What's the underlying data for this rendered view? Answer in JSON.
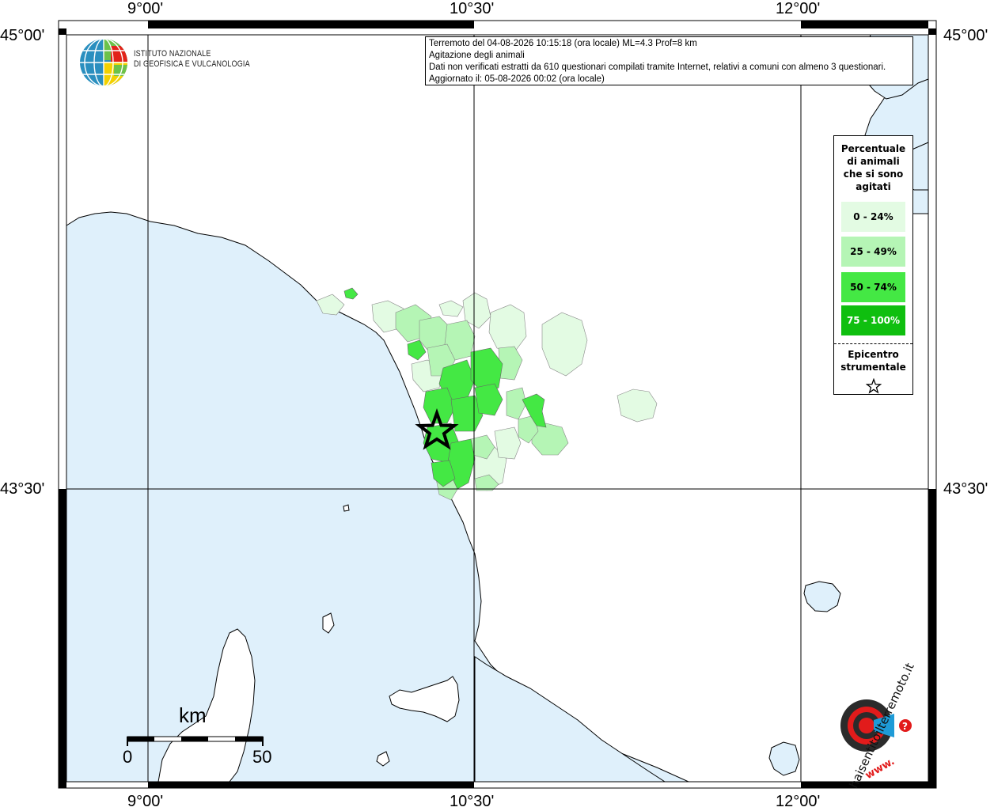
{
  "map": {
    "longitude_labels": [
      "9°00'",
      "10°30'",
      "12°00'"
    ],
    "latitude_labels": [
      "45°00'",
      "43°30'"
    ],
    "colors": {
      "sea": "#dff0fb",
      "land": "#ffffff",
      "class_0_24": "#e3fbe3",
      "class_25_49": "#b5f5b5",
      "class_50_74": "#44e844",
      "class_75_100": "#0fbf0f"
    }
  },
  "logo": {
    "line1": "ISTITUTO NAZIONALE",
    "line2": "DI GEOFISICA E VULCANOLOGIA"
  },
  "info": {
    "line1": "Terremoto del 04-08-2026 10:15:18 (ora locale) ML=4.3 Prof=8 km",
    "line2": "Agitazione degli animali",
    "line3": "Dati non verificati estratti da 610 questionari compilati tramite Internet, relativi a comuni con almeno 3 questionari.",
    "line4": "Aggiornato il: 05-08-2026 00:02 (ora locale)"
  },
  "legend": {
    "title_lines": [
      "Percentuale",
      "di animali",
      "che si sono",
      "agitati"
    ],
    "items": [
      {
        "label": "0 - 24%",
        "color": "#e3fbe3",
        "text_color": "#000000"
      },
      {
        "label": "25 - 49%",
        "color": "#b5f5b5",
        "text_color": "#000000"
      },
      {
        "label": "50 - 74%",
        "color": "#44e844",
        "text_color": "#000000"
      },
      {
        "label": "75 - 100%",
        "color": "#0fbf0f",
        "text_color": "#ffffff"
      }
    ],
    "epicenter_lines": [
      "Epicentro",
      "strumentale"
    ]
  },
  "scale": {
    "unit": "km",
    "min": "0",
    "max": "50"
  },
  "brand": {
    "text": "haisentitoilterremoto.it",
    "url_text": "www."
  }
}
